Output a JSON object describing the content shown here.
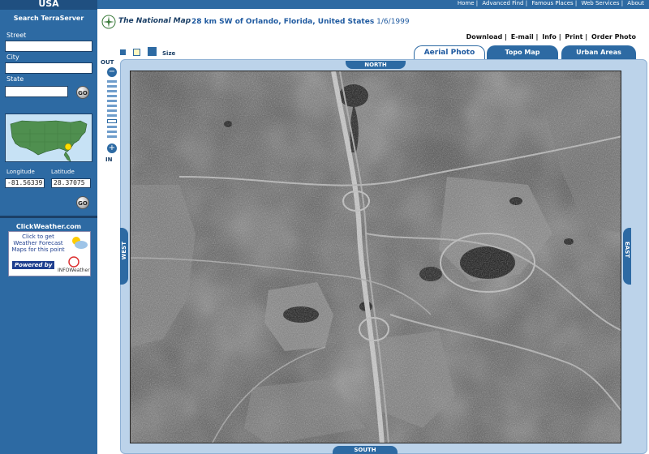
{
  "sidebar": {
    "brand": "USA",
    "search_title": "Search TerraServer",
    "street_label": "Street",
    "city_label": "City",
    "state_label": "State",
    "go_label": "GO",
    "longitude_label": "Longitude",
    "latitude_label": "Latitude",
    "longitude_value": "-81.56339",
    "latitude_value": "28.37075",
    "clickweather": {
      "title": "ClickWeather.com",
      "line1": "Click to get",
      "line2": "Weather Forecast",
      "line3": "Maps for this point",
      "powered": "Powered by",
      "brand": "INFOWeather"
    }
  },
  "topnav": {
    "items": [
      "Home",
      "Advanced Find",
      "Famous Places",
      "Web Services",
      "About"
    ]
  },
  "header": {
    "logo_text": "The National Map",
    "location": "28 km SW of Orlando, Florida, United States",
    "date": "1/6/1999"
  },
  "toolbar": {
    "links": [
      "Download",
      "E-mail",
      "Info",
      "Print",
      "Order Photo"
    ],
    "size_label": "Size"
  },
  "tabs": [
    {
      "label": "Aerial Photo",
      "active": true
    },
    {
      "label": "Topo Map",
      "active": false
    },
    {
      "label": "Urban Areas",
      "active": false
    }
  ],
  "navigation": {
    "north": "NORTH",
    "south": "SOUTH",
    "east": "EAST",
    "west": "WEST",
    "zoom_out": "OUT",
    "zoom_in": "IN"
  },
  "colors": {
    "sidebar": "#2d6aa3",
    "accent": "#1f5aa0",
    "frame": "#bcd3ea"
  }
}
